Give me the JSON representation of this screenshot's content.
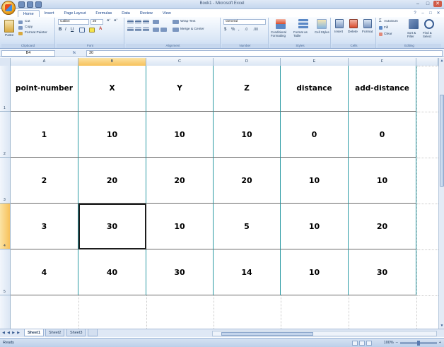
{
  "window": {
    "title": "Book1 - Microsoft Excel"
  },
  "ribbon": {
    "tabs": [
      "Home",
      "Insert",
      "Page Layout",
      "Formulas",
      "Data",
      "Review",
      "View"
    ],
    "active_tab": "Home",
    "clipboard": {
      "paste": "Paste",
      "cut": "Cut",
      "copy": "Copy",
      "format_painter": "Format Painter",
      "label": "Clipboard"
    },
    "font": {
      "name": "Calibri",
      "size": "20",
      "label": "Font"
    },
    "alignment": {
      "wrap_text": "Wrap Text",
      "merge_center": "Merge & Center",
      "label": "Alignment"
    },
    "number": {
      "format": "General",
      "label": "Number"
    },
    "styles": {
      "conditional": "Conditional Formatting",
      "format_table": "Format as Table",
      "cell_styles": "Cell Styles",
      "label": "Styles"
    },
    "cells": {
      "insert": "Insert",
      "delete": "Delete",
      "format": "Format",
      "label": "Cells"
    },
    "editing": {
      "autosum": "AutoSum",
      "fill": "Fill",
      "clear": "Clear",
      "sort_filter": "Sort & Filter",
      "find_select": "Find & Select",
      "label": "Editing"
    }
  },
  "formula_bar": {
    "name_box": "B4",
    "fx": "fx",
    "value": "30"
  },
  "grid": {
    "columns": [
      "A",
      "B",
      "C",
      "D",
      "E",
      "F"
    ],
    "selected_column": "B",
    "rows": [
      "1",
      "2",
      "3",
      "4",
      "5"
    ],
    "selected_row": "4",
    "header_row": [
      "point-number",
      "X",
      "Y",
      "Z",
      "distance",
      "add-distance"
    ],
    "data": [
      [
        "1",
        "10",
        "10",
        "10",
        "0",
        "0"
      ],
      [
        "2",
        "20",
        "20",
        "20",
        "10",
        "10"
      ],
      [
        "3",
        "30",
        "10",
        "5",
        "10",
        "20"
      ],
      [
        "4",
        "40",
        "30",
        "14",
        "10",
        "30"
      ]
    ]
  },
  "sheets": [
    "Sheet1",
    "Sheet2",
    "Sheet3"
  ],
  "active_sheet": "Sheet1",
  "status": {
    "text": "Ready",
    "zoom": "100%"
  }
}
